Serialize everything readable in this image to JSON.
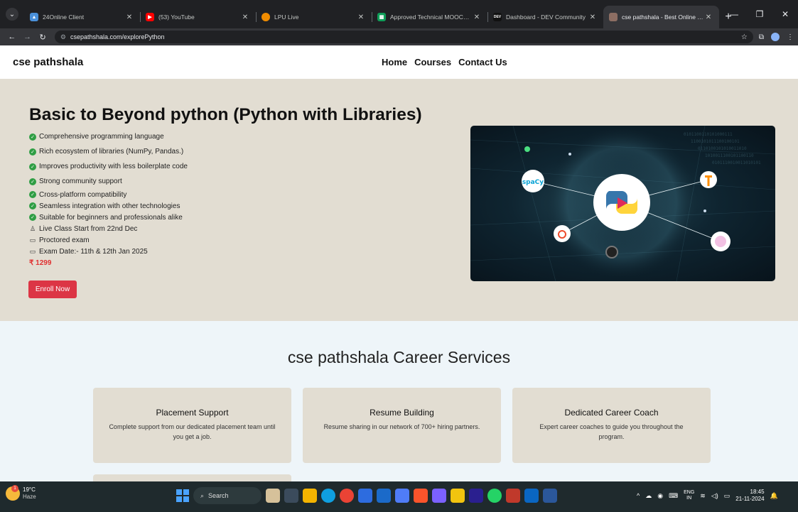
{
  "browser": {
    "tabs": [
      {
        "label": "24Online Client",
        "icon": "cloud-icon",
        "color": "#4a90d9"
      },
      {
        "label": "(53) YouTube",
        "icon": "youtube-icon",
        "color": "#ff0000"
      },
      {
        "label": "LPU Live",
        "icon": "lpu-icon",
        "color": "#f08c00"
      },
      {
        "label": "Approved Technical MOOCs - G",
        "icon": "sheets-icon",
        "color": "#0f9d58"
      },
      {
        "label": "Dashboard - DEV Community",
        "icon": "dev-icon",
        "color": "#111111"
      },
      {
        "label": "cse pathshala - Best Online Tut",
        "icon": "site-icon",
        "color": "#8d6e63"
      }
    ],
    "url": "csepathshala.com/explorePython"
  },
  "site": {
    "brand": "cse pathshala",
    "menu": [
      "Home",
      "Courses",
      "Contact Us"
    ]
  },
  "hero": {
    "title": "Basic to Beyond python (Python with Libraries)",
    "features": [
      "Comprehensive programming language",
      "Rich ecosystem of libraries (NumPy, Pandas.)",
      "Improves productivity with less boilerplate code",
      "Strong community support",
      "Cross-platform compatibility",
      "Seamless integration with other technologies",
      "Suitable for beginners and professionals alike"
    ],
    "details": [
      {
        "icon": "person-icon",
        "text": "Live Class Start from 22nd Dec"
      },
      {
        "icon": "laptop-icon",
        "text": "Proctored exam"
      },
      {
        "icon": "laptop-icon",
        "text": "Exam Date:- 11th & 12th Jan 2025"
      }
    ],
    "price": "₹ 1299",
    "enroll_label": "Enroll Now",
    "image_label": "spaCy"
  },
  "career": {
    "title": "cse pathshala Career Services",
    "cards": [
      {
        "title": "Placement Support",
        "text": "Complete support from our dedicated placement team until you get a job."
      },
      {
        "title": "Resume Building",
        "text": "Resume sharing in our network of 700+ hiring partners."
      },
      {
        "title": "Dedicated Career Coach",
        "text": "Expert career coaches to guide you throughout the program."
      }
    ]
  },
  "taskbar": {
    "temp": "19°C",
    "weather": "Haze",
    "notification_count": "1",
    "search": "Search",
    "lang1": "ENG",
    "lang2": "IN",
    "time": "18:45",
    "date": "21-11-2024"
  },
  "colors": {
    "accent": "#dc3545",
    "price": "#e03131",
    "hero_bg": "#e2ddd2",
    "career_bg": "#eef5f9",
    "check": "#2f9e44"
  }
}
